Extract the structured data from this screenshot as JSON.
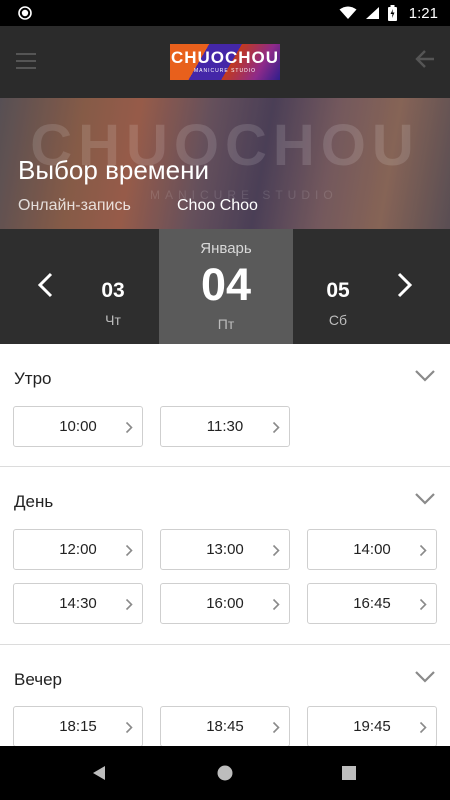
{
  "status_bar": {
    "time": "1:21"
  },
  "logo": {
    "text": "CHUOCHOU",
    "subtext": "MANICURE STUDIO"
  },
  "hero": {
    "background_text": "CHUOCHOU",
    "background_subtext": "MANICURE STUDIO",
    "title": "Выбор времени",
    "subtitle": "Онлайн-запись",
    "studio": "Choo Choo"
  },
  "date_selector": {
    "month": "Январь",
    "prev_day": {
      "num": "03",
      "weekday": "Чт"
    },
    "current_day": {
      "num": "04",
      "weekday": "Пт"
    },
    "next_day": {
      "num": "05",
      "weekday": "Сб"
    }
  },
  "sections": [
    {
      "title": "Утро",
      "slots": [
        "10:00",
        "11:30"
      ]
    },
    {
      "title": "День",
      "slots": [
        "12:00",
        "13:00",
        "14:00",
        "14:30",
        "16:00",
        "16:45"
      ]
    },
    {
      "title": "Вечер",
      "slots": [
        "18:15",
        "18:45",
        "19:45"
      ]
    }
  ],
  "colors": {
    "appbar": "#2b2b2b",
    "datebar": "#2e2e2e",
    "selected_day": "#5a5a5a",
    "slot_border": "#cfcfcf",
    "chevron": "#8a8a8a"
  }
}
